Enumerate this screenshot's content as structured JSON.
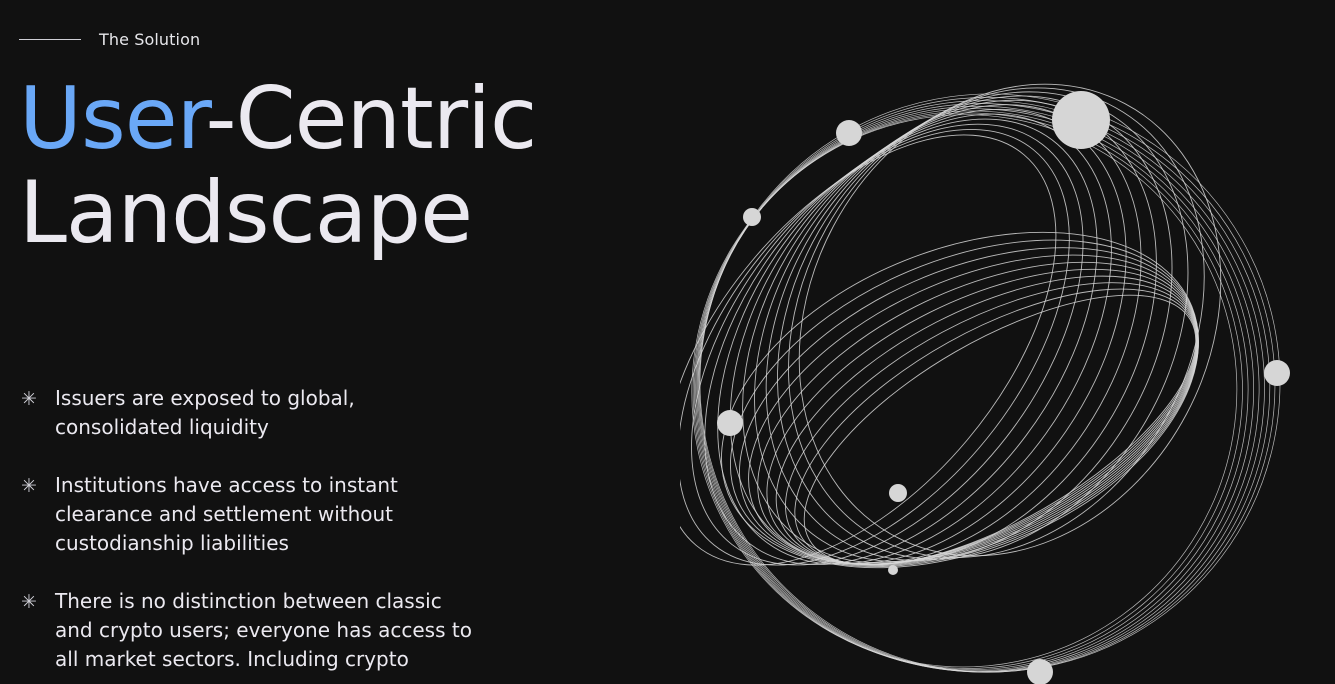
{
  "section": {
    "eyebrow": "The Solution"
  },
  "headline": {
    "accent": "User",
    "rest": "-Centric",
    "line2": "Landscape"
  },
  "bullets": [
    {
      "icon": "sparkle-asterisk-icon",
      "text": "Issuers are exposed to global, consolidated liquidity"
    },
    {
      "icon": "sparkle-asterisk-icon",
      "text": "Institutions have access to instant clearance and settlement without custodianship liabilities"
    },
    {
      "icon": "sparkle-asterisk-icon",
      "text": "There is no distinction between classic and crypto users; everyone has access to all market sectors. Including crypto"
    }
  ],
  "colors": {
    "background": "#111111",
    "accent": "#6aa8f7",
    "text": "#ebe9f0",
    "graphic": "#d8d8d8"
  }
}
